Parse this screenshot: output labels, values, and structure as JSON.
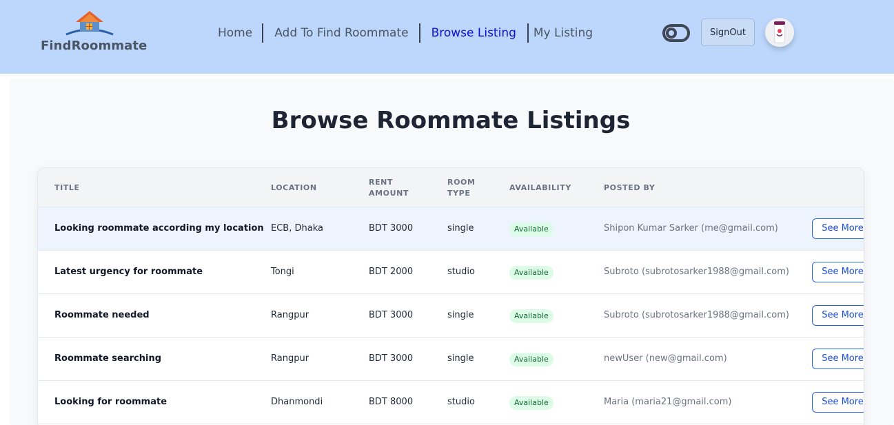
{
  "brand": {
    "name": "FindRoommate"
  },
  "nav": {
    "items": [
      {
        "label": "Home",
        "active": false
      },
      {
        "label": "Add To Find Roommate",
        "active": false
      },
      {
        "label": "Browse Listing",
        "active": true
      },
      {
        "label": "My Listing",
        "active": false
      }
    ]
  },
  "header": {
    "theme_toggle_icon": "toggle-icon",
    "signout_label": "SignOut",
    "avatar_icon": "user-avatar"
  },
  "page": {
    "title": "Browse Roommate Listings"
  },
  "table": {
    "columns": [
      "TITLE",
      "LOCATION",
      "RENT AMOUNT",
      "ROOM TYPE",
      "AVAILABILITY",
      "POSTED BY"
    ],
    "rows": [
      {
        "title": "Looking roommate according my location",
        "location": "ECB, Dhaka",
        "rent": "BDT 3000",
        "room_type": "single",
        "availability": "Available",
        "posted_by": "Shipon Kumar Sarker (me@gmail.com)",
        "action": "See More"
      },
      {
        "title": "Latest urgency for roommate",
        "location": "Tongi",
        "rent": "BDT 2000",
        "room_type": "studio",
        "availability": "Available",
        "posted_by": "Subroto (subrotosarker1988@gmail.com)",
        "action": "See More"
      },
      {
        "title": "Roommate needed",
        "location": "Rangpur",
        "rent": "BDT 3000",
        "room_type": "single",
        "availability": "Available",
        "posted_by": "Subroto (subrotosarker1988@gmail.com)",
        "action": "See More"
      },
      {
        "title": "Roommate searching",
        "location": "Rangpur",
        "rent": "BDT 3000",
        "room_type": "single",
        "availability": "Available",
        "posted_by": "newUser (new@gmail.com)",
        "action": "See More"
      },
      {
        "title": "Looking for roommate",
        "location": "Dhanmondi",
        "rent": "BDT 8000",
        "room_type": "studio",
        "availability": "Available",
        "posted_by": "Maria (maria21@gmail.com)",
        "action": "See More"
      }
    ]
  },
  "colors": {
    "navbar_bg": "#bcd7fb",
    "active_link": "#1010d6",
    "badge_bg": "#dcfce7",
    "badge_text": "#166534",
    "button_border": "#2563eb"
  }
}
